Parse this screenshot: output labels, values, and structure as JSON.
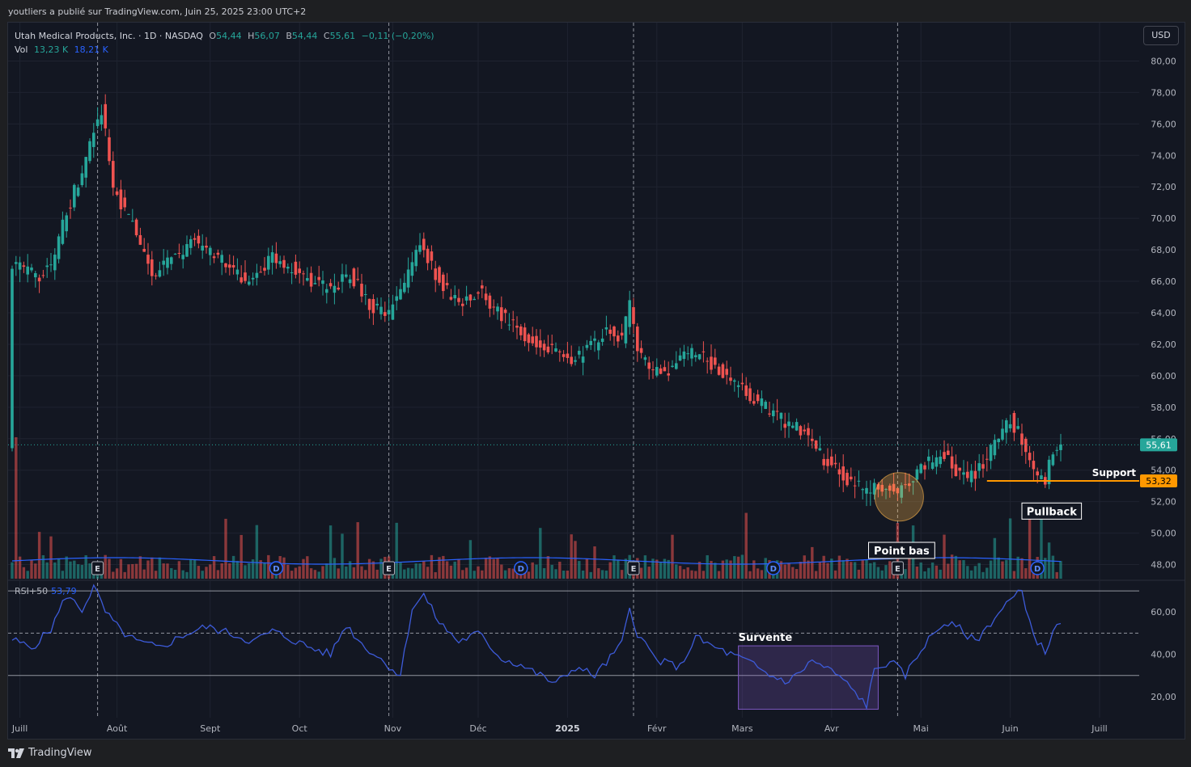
{
  "header": {
    "publisher_line": "youtliers a publié sur TradingView.com, Juin 25, 2025 23:00 UTC+2"
  },
  "legend": {
    "symbol": "Utah Medical Products, Inc. · 1D · NASDAQ",
    "open_label": "O",
    "open": "54,44",
    "high_label": "H",
    "high": "56,07",
    "low_label": "B",
    "low": "54,44",
    "close_label": "C",
    "close": "55,61",
    "change": "−0,11 (−0,20%)",
    "vol_label": "Vol",
    "vol_value": "13,23 K",
    "vol_ma": "18,21 K"
  },
  "currency_button": "USD",
  "rsi_legend": {
    "label": "RSI+50",
    "value": "53,79"
  },
  "footer": {
    "brand": "TradingView"
  },
  "colors": {
    "up": "#26a69a",
    "down": "#ef5350",
    "rsi": "#3d5bd9",
    "support": "#ff9800",
    "background": "#131722",
    "grid": "#1f2330"
  },
  "chart_data": {
    "type": "candlestick",
    "x_ticks": [
      "Juill",
      "Août",
      "Sept",
      "Oct",
      "Nov",
      "Déc",
      "2025",
      "Févr",
      "Mars",
      "Avr",
      "Mai",
      "Juin",
      "Juill"
    ],
    "y_ticks": [
      "48,00",
      "50,00",
      "52,00",
      "54,00",
      "56,00",
      "58,00",
      "60,00",
      "62,00",
      "64,00",
      "66,00",
      "68,00",
      "70,00",
      "72,00",
      "74,00",
      "76,00",
      "78,00",
      "80,00"
    ],
    "ylim": [
      47,
      81
    ],
    "last_price_label": "55,61",
    "last_price": 55.61,
    "support_label": "53,32",
    "support_price": 53.32,
    "price_path": [
      [
        0,
        67.2
      ],
      [
        6,
        66.3
      ],
      [
        10,
        66.8
      ],
      [
        14,
        70.5
      ],
      [
        18,
        73
      ],
      [
        21,
        75.5
      ],
      [
        23,
        77
      ],
      [
        26,
        72
      ],
      [
        31,
        69.5
      ],
      [
        36,
        66.5
      ],
      [
        42,
        67.5
      ],
      [
        47,
        68.5
      ],
      [
        52,
        67.8
      ],
      [
        57,
        66.5
      ],
      [
        62,
        66
      ],
      [
        67,
        67.5
      ],
      [
        72,
        66.8
      ],
      [
        77,
        66
      ],
      [
        82,
        65.5
      ],
      [
        87,
        66.5
      ],
      [
        92,
        64.5
      ],
      [
        97,
        63.8
      ],
      [
        102,
        66.5
      ],
      [
        105,
        68.5
      ],
      [
        110,
        66
      ],
      [
        115,
        64.5
      ],
      [
        120,
        65.5
      ],
      [
        125,
        64
      ],
      [
        130,
        63
      ],
      [
        135,
        62
      ],
      [
        140,
        61.5
      ],
      [
        145,
        61
      ],
      [
        150,
        62
      ],
      [
        153,
        63
      ],
      [
        157,
        62.5
      ],
      [
        159,
        64.5
      ],
      [
        161,
        61.5
      ],
      [
        166,
        60.2
      ],
      [
        170,
        60.5
      ],
      [
        174,
        61.5
      ],
      [
        179,
        61
      ],
      [
        184,
        60
      ],
      [
        189,
        59
      ],
      [
        194,
        58
      ],
      [
        199,
        57
      ],
      [
        204,
        56.5
      ],
      [
        208,
        55
      ],
      [
        212,
        54
      ],
      [
        216,
        53.3
      ],
      [
        220,
        52.5
      ],
      [
        224,
        53
      ],
      [
        228,
        52.4
      ],
      [
        232,
        53.5
      ],
      [
        236,
        54.5
      ],
      [
        240,
        55
      ],
      [
        243,
        54
      ],
      [
        246,
        53.3
      ],
      [
        250,
        54.5
      ],
      [
        254,
        56
      ],
      [
        257,
        57.2
      ],
      [
        260,
        56
      ],
      [
        263,
        53.8
      ],
      [
        266,
        53.5
      ],
      [
        268,
        55
      ],
      [
        270,
        55.61
      ]
    ],
    "events": [
      {
        "type": "E",
        "label": "E",
        "t": 22
      },
      {
        "type": "D",
        "label": "D",
        "t": 68
      },
      {
        "type": "E",
        "label": "E",
        "t": 97
      },
      {
        "type": "D",
        "label": "D",
        "t": 131
      },
      {
        "type": "E",
        "label": "E",
        "t": 160
      },
      {
        "type": "D",
        "label": "D",
        "t": 196
      },
      {
        "type": "E",
        "label": "E",
        "t": 228
      },
      {
        "type": "D",
        "label": "D",
        "t": 264
      }
    ],
    "earnings_lines_t": [
      22,
      97,
      160,
      228
    ],
    "annotations": [
      {
        "label": "Support"
      },
      {
        "label": "Pullback"
      },
      {
        "label": "Point bas"
      },
      {
        "label": "Survente"
      }
    ],
    "rsi": {
      "ylim": [
        10,
        75
      ],
      "y_ticks": [
        "20,00",
        "40,00",
        "60,00"
      ],
      "upper": 70,
      "middle": 50,
      "lower": 30,
      "oversold_zone": {
        "t_start": 187,
        "t_end": 223,
        "y_low": 14,
        "y_high": 44
      },
      "path": [
        [
          0,
          47
        ],
        [
          5,
          43
        ],
        [
          10,
          52
        ],
        [
          14,
          68
        ],
        [
          18,
          61
        ],
        [
          21,
          72
        ],
        [
          24,
          60
        ],
        [
          28,
          51
        ],
        [
          32,
          46
        ],
        [
          38,
          43
        ],
        [
          44,
          49
        ],
        [
          50,
          53
        ],
        [
          56,
          50
        ],
        [
          62,
          46
        ],
        [
          67,
          51
        ],
        [
          72,
          47
        ],
        [
          77,
          43
        ],
        [
          82,
          40
        ],
        [
          86,
          54
        ],
        [
          90,
          45
        ],
        [
          96,
          36
        ],
        [
          100,
          30
        ],
        [
          103,
          62
        ],
        [
          106,
          68
        ],
        [
          110,
          55
        ],
        [
          115,
          46
        ],
        [
          120,
          50
        ],
        [
          126,
          38
        ],
        [
          131,
          35
        ],
        [
          136,
          30
        ],
        [
          140,
          26
        ],
        [
          145,
          34
        ],
        [
          150,
          30
        ],
        [
          153,
          36
        ],
        [
          157,
          45
        ],
        [
          159,
          62
        ],
        [
          161,
          50
        ],
        [
          166,
          37
        ],
        [
          172,
          34
        ],
        [
          176,
          48
        ],
        [
          180,
          44
        ],
        [
          185,
          40
        ],
        [
          190,
          36
        ],
        [
          195,
          30
        ],
        [
          200,
          27
        ],
        [
          206,
          37
        ],
        [
          212,
          31
        ],
        [
          216,
          24
        ],
        [
          220,
          16
        ],
        [
          222,
          32
        ],
        [
          226,
          37
        ],
        [
          230,
          30
        ],
        [
          235,
          45
        ],
        [
          240,
          55
        ],
        [
          244,
          52
        ],
        [
          248,
          46
        ],
        [
          252,
          55
        ],
        [
          256,
          64
        ],
        [
          260,
          70
        ],
        [
          263,
          49
        ],
        [
          266,
          41
        ],
        [
          268,
          51
        ],
        [
          270,
          53.8
        ]
      ]
    }
  }
}
